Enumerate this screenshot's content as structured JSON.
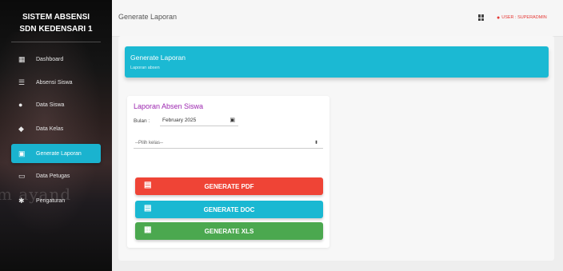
{
  "sidebar": {
    "title_line1": "SISTEM ABSENSI",
    "title_line2": "SDN KEDENSARI 1",
    "watermark": "m ayand",
    "items": [
      {
        "label": "Dashboard",
        "icon": "dashboard-icon"
      },
      {
        "label": "Absensi Siswa",
        "icon": "checklist-icon"
      },
      {
        "label": "Data Siswa",
        "icon": "person-icon"
      },
      {
        "label": "Data Kelas",
        "icon": "school-icon"
      },
      {
        "label": "Generate Laporan",
        "icon": "printer-icon",
        "active": true
      },
      {
        "label": "Data Petugas",
        "icon": "monitor-icon"
      },
      {
        "label": "Pengaturan",
        "icon": "gear-icon"
      }
    ]
  },
  "topbar": {
    "title": "Generate Laporan",
    "user_label": "USER : SUPERADMIN"
  },
  "header": {
    "title": "Generate Laporan",
    "subtitle": "Laporan absen"
  },
  "form": {
    "title": "Laporan Absen Siswa",
    "bulan_label": "Bulan :",
    "bulan_value": "February 2025",
    "kelas_placeholder": "--Pilih kelas--"
  },
  "buttons": {
    "pdf": "GENERATE PDF",
    "doc": "GENERATE DOC",
    "xls": "GENERATE XLS"
  },
  "colors": {
    "accent": "#1ab8d2",
    "pdf": "#ef4436",
    "xls": "#4ba84f",
    "title_purple": "#9c27b0",
    "user_red": "#e53935"
  }
}
